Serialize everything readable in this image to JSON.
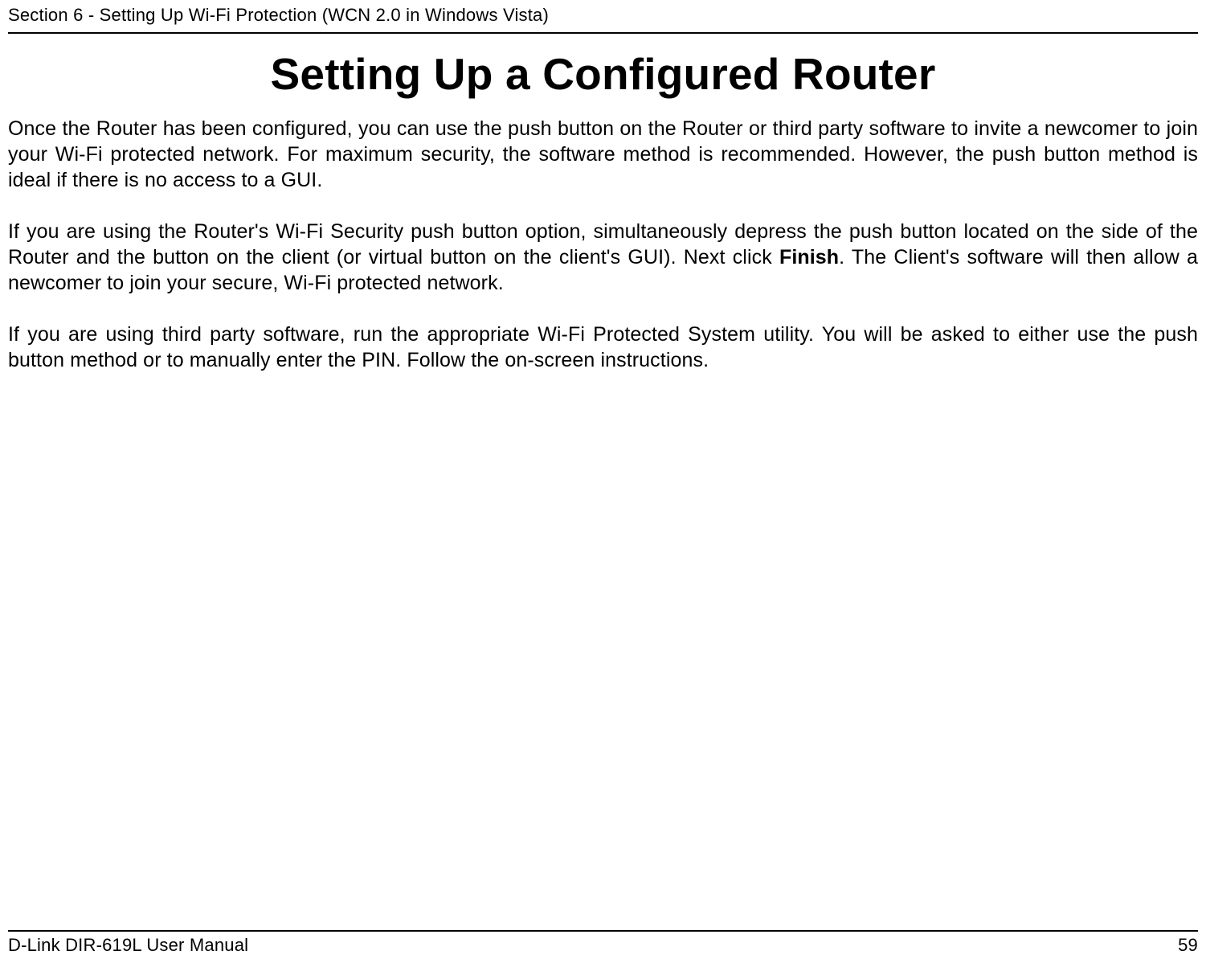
{
  "header": {
    "section_label": "Section 6 - Setting Up Wi-Fi Protection (WCN 2.0 in Windows Vista)"
  },
  "title": "Setting Up a Configured Router",
  "paragraphs": {
    "p1": "Once the Router has been configured, you can use the push button on the Router or third party software to invite a newcomer to join your Wi-Fi protected network. For maximum security, the software method is recommended. However, the push button method is ideal if there is no access to a GUI.",
    "p2_before": "If you are using the Router's Wi-Fi Security push button option, simultaneously depress the push button located on the side of the Router and the button on the client (or virtual button on the client's GUI). Next click ",
    "p2_bold": "Finish",
    "p2_after": ". The Client's software will then allow a newcomer to join your secure, Wi-Fi protected network.",
    "p3": "If you are using third party software, run the appropriate Wi-Fi Protected System utility. You will be asked to either use the push button method or to manually enter the PIN. Follow the on-screen instructions."
  },
  "footer": {
    "manual_label": "D-Link DIR-619L User Manual",
    "page_number": "59"
  }
}
